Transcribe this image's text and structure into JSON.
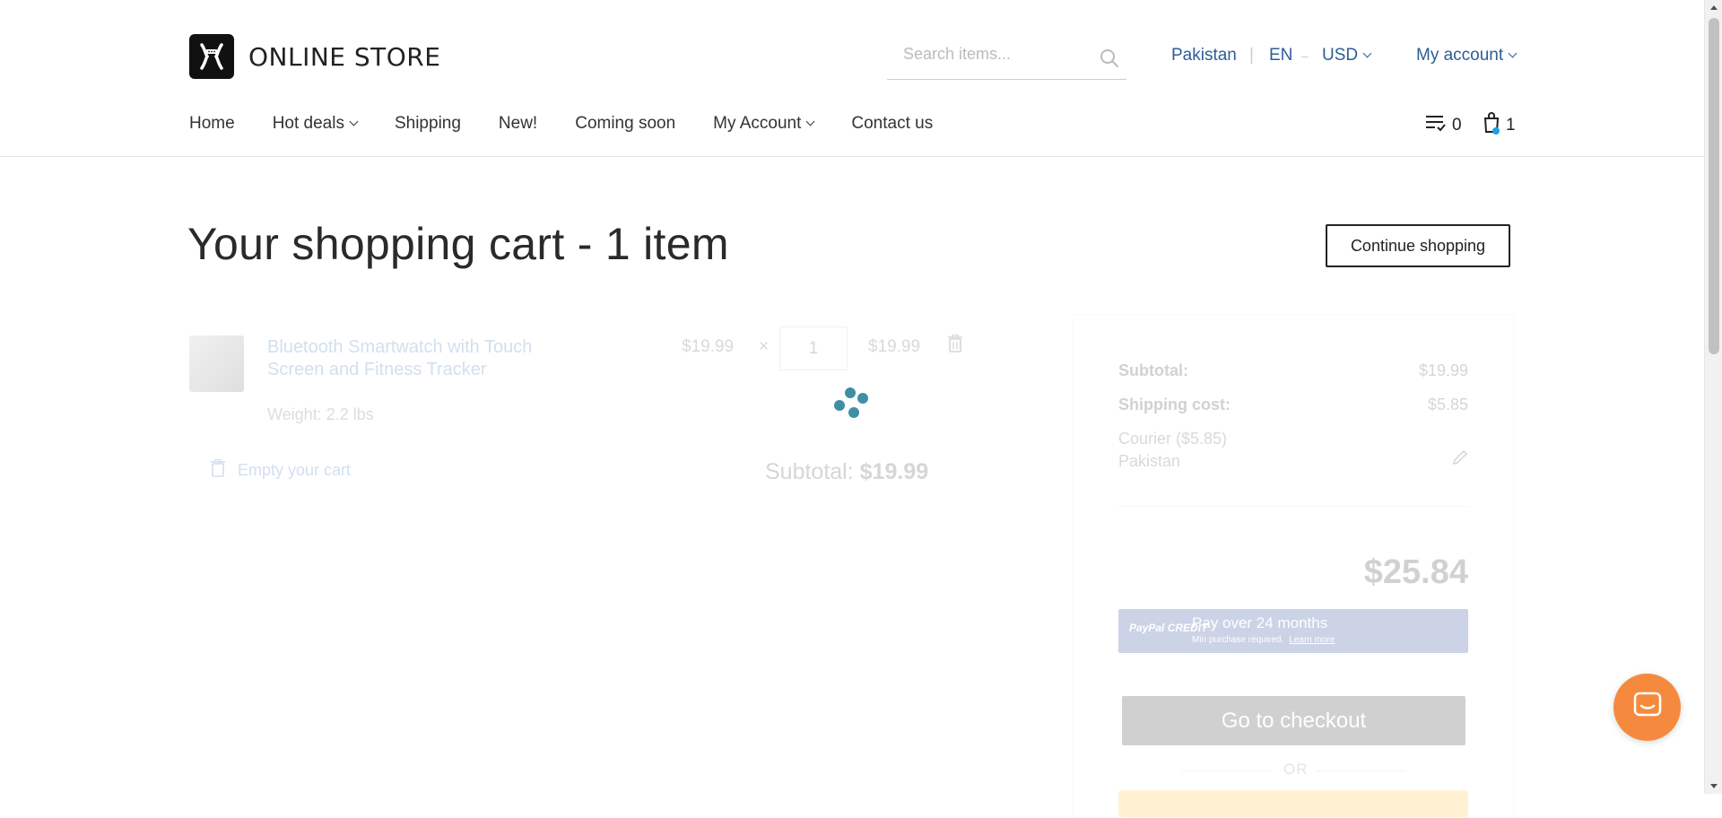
{
  "header": {
    "logo_text": "ONLINE STORE",
    "search_placeholder": "Search items...",
    "country": "Pakistan",
    "separator": "|",
    "language": "EN",
    "lang_currency_separator": "–",
    "currency": "USD",
    "my_account": "My account"
  },
  "nav": {
    "items": [
      {
        "label": "Home",
        "has_dropdown": false
      },
      {
        "label": "Hot deals",
        "has_dropdown": true
      },
      {
        "label": "Shipping",
        "has_dropdown": false
      },
      {
        "label": "New!",
        "has_dropdown": false
      },
      {
        "label": "Coming soon",
        "has_dropdown": false
      },
      {
        "label": "My Account",
        "has_dropdown": true
      },
      {
        "label": "Contact us",
        "has_dropdown": false
      }
    ],
    "wishlist_count": "0",
    "cart_count": "1"
  },
  "page": {
    "title": "Your shopping cart - 1 item",
    "continue_label": "Continue shopping"
  },
  "cart": {
    "item": {
      "name": "Bluetooth Smartwatch with Touch Screen and Fitness Tracker",
      "weight": "Weight: 2.2 lbs",
      "price": "$19.99",
      "times": "×",
      "quantity": "1",
      "total": "$19.99"
    },
    "empty_label": "Empty your cart",
    "subtotal_label": "Subtotal:",
    "subtotal_value": "$19.99"
  },
  "summary": {
    "subtotal_label": "Subtotal:",
    "subtotal_value": "$19.99",
    "shipping_label": "Shipping cost:",
    "shipping_value": "$5.85",
    "shipping_method": "Courier ($5.85)",
    "shipping_country": "Pakistan",
    "total": "$25.84",
    "paypal_badge": "PayPal CREDIT",
    "paypal_main": "Pay over 24 months",
    "paypal_sub": "Min purchase required.",
    "paypal_link": "Learn more",
    "checkout_label": "Go to checkout",
    "or_label": "OR"
  },
  "colors": {
    "link": "#2f6fb5",
    "spinner": "#3f8fa3",
    "chat": "#f58a3e",
    "checkout": "#2d2d2d"
  }
}
